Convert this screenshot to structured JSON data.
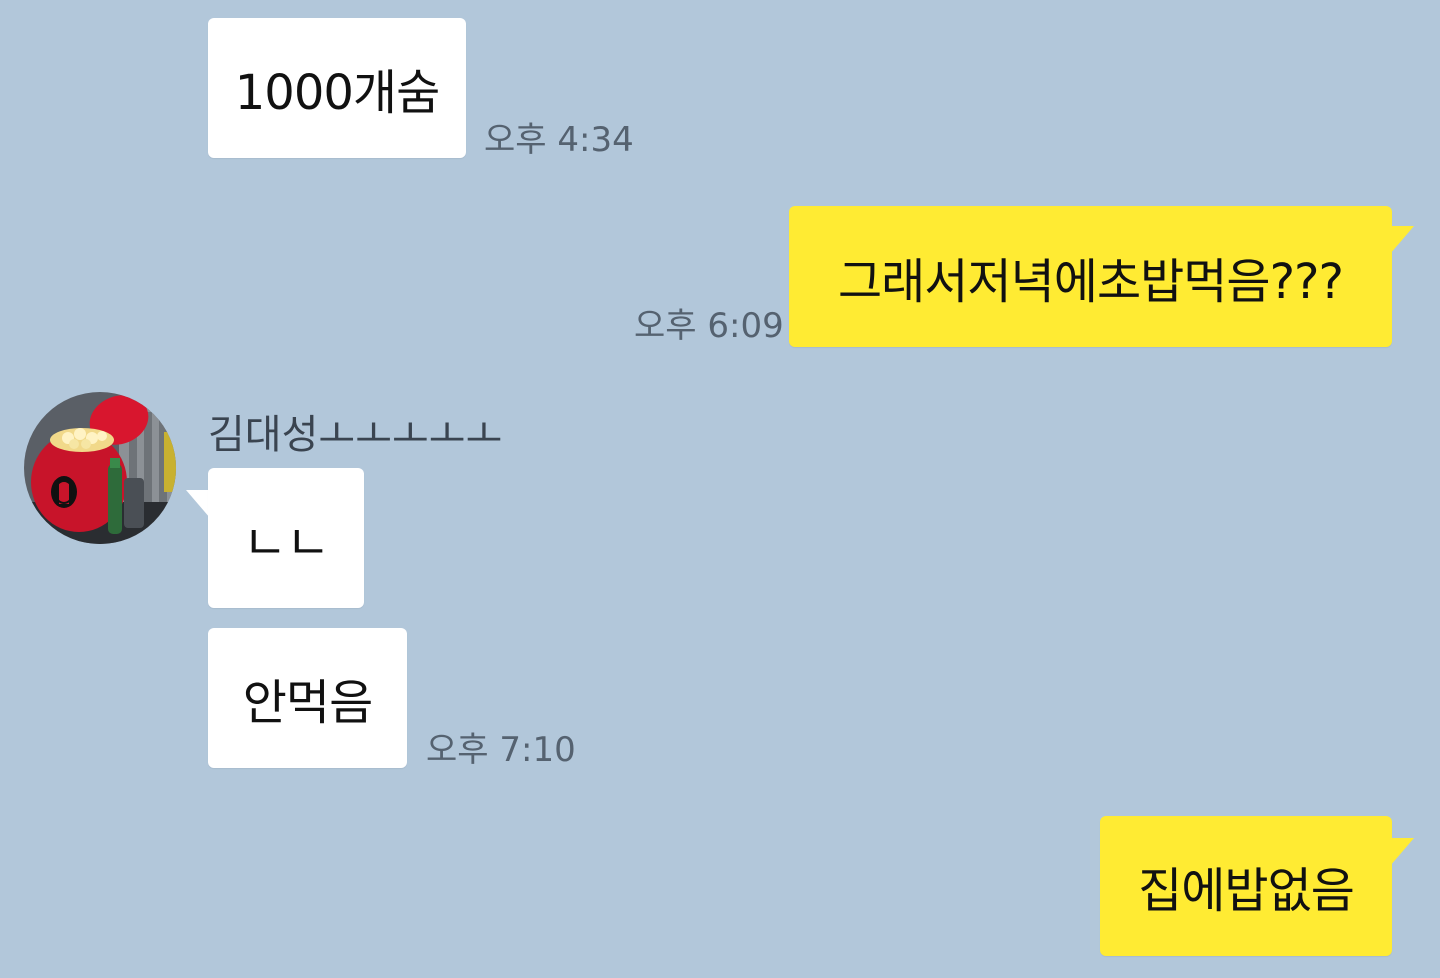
{
  "messages": [
    {
      "text": "1000개숨",
      "time": "오후 4:34",
      "direction": "incoming"
    },
    {
      "text": "그래서저녁에초밥먹음???",
      "time": "오후 6:09",
      "direction": "outgoing"
    },
    {
      "text": "ㄴㄴ",
      "direction": "incoming"
    },
    {
      "text": "안먹음",
      "time": "오후 7:10",
      "direction": "incoming"
    },
    {
      "text": "집에밥없음",
      "direction": "outgoing"
    }
  ],
  "sender": {
    "name": "김대성ㅗㅗㅗㅗㅗ",
    "avatar": "deadpool-popcorn-avatar"
  },
  "colors": {
    "background": "#b2c7da",
    "incoming_bubble": "#ffffff",
    "outgoing_bubble": "#ffeb33",
    "time_text": "#556270"
  }
}
